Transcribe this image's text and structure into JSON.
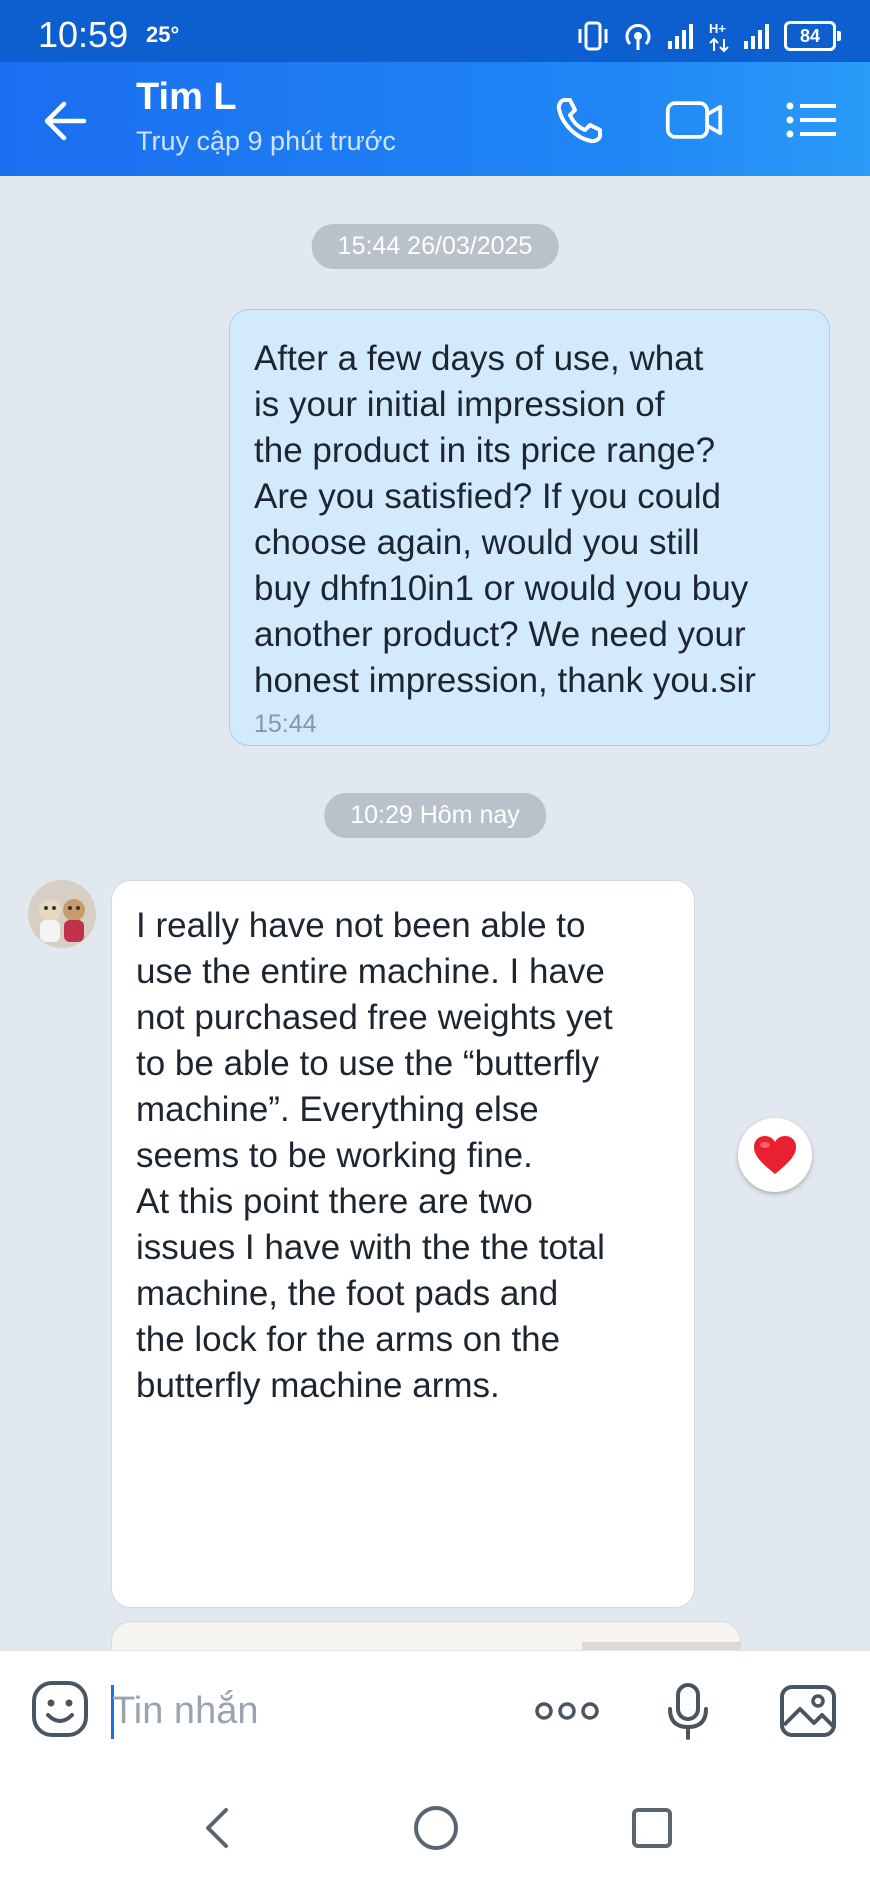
{
  "status_bar": {
    "time": "10:59",
    "temperature": "25°",
    "battery": "84",
    "icons": [
      "vibrate-icon",
      "hotspot-icon",
      "signal-icon",
      "network-type-icon",
      "signal-icon",
      "battery-icon"
    ]
  },
  "header": {
    "contact_name": "Tim L",
    "contact_status": "Truy cập 9 phút trước",
    "icons": [
      "back-arrow-icon",
      "phone-call-icon",
      "video-call-icon",
      "menu-list-icon"
    ],
    "accent_color": "#1b6ef0"
  },
  "chat": {
    "timestamp_1": "15:44 26/03/2025",
    "outgoing_message": "After a few days of use, what\nis your initial impression of\nthe product in its price range?\nAre you satisfied? If you could\nchoose again, would you still\nbuy dhfn10in1 or would you buy\nanother product? We need your\nhonest impression, thank you.sir",
    "outgoing_time": "15:44",
    "timestamp_2": "10:29 Hôm nay",
    "incoming_message": "I really have not been able to\nuse the entire machine. I have\nnot purchased free weights yet\nto be able to use the “butterfly\nmachine”. Everything else\nseems to be working fine.\nAt this point there are two\nissues I have with the the total\nmachine, the foot pads and\nthe lock for the arms on the\nbutterfly machine arms.",
    "reaction": "heart-icon",
    "image_message": "gym-machine-photo"
  },
  "composer": {
    "placeholder": "Tin nhắn",
    "icons": [
      "emoji-icon",
      "more-options-icon",
      "microphone-icon",
      "gallery-icon"
    ]
  },
  "nav": {
    "icons": [
      "nav-back-icon",
      "nav-home-icon",
      "nav-recents-icon"
    ]
  }
}
